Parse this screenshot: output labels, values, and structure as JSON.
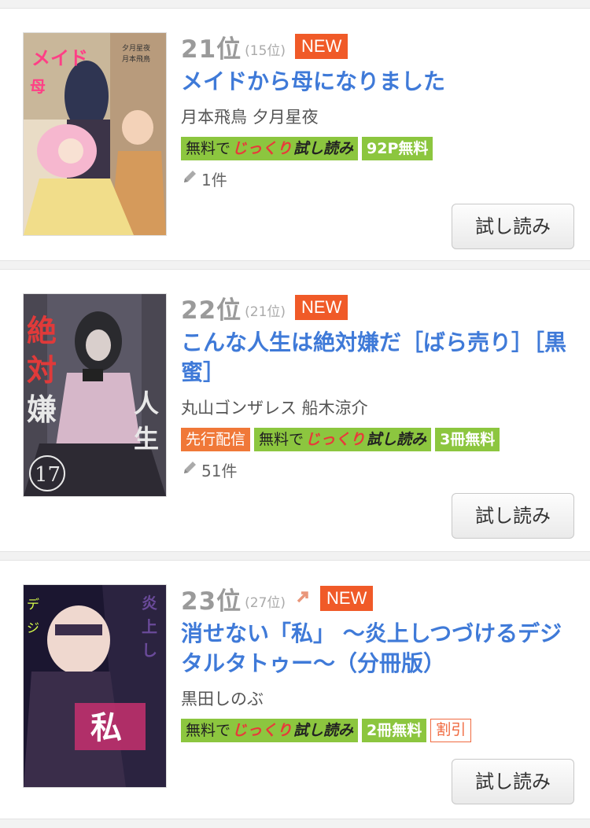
{
  "items": [
    {
      "rank": "21位",
      "prev": "(15位)",
      "new_badge": "NEW",
      "title": "メイドから母になりました",
      "authors": "月本飛鳥 夕月星夜",
      "trial": {
        "free": "無料で",
        "slow": "じっくり",
        "read": "試し読み"
      },
      "badge_free": "92P無料",
      "review_count": "1件",
      "button": "試し読み"
    },
    {
      "rank": "22位",
      "prev": "(21位)",
      "new_badge": "NEW",
      "title": "こんな人生は絶対嫌だ［ばら売り］［黒蜜］",
      "authors": "丸山ゴンザレス 船木涼介",
      "pre_release": "先行配信",
      "trial": {
        "free": "無料で",
        "slow": "じっくり",
        "read": "試し読み"
      },
      "badge_free": "3冊無料",
      "review_count": "51件",
      "button": "試し読み"
    },
    {
      "rank": "23位",
      "prev": "(27位)",
      "new_badge": "NEW",
      "title": "消せない「私」 ～炎上しつづけるデジタルタトゥー～（分冊版）",
      "authors": "黒田しのぶ",
      "trial": {
        "free": "無料で",
        "slow": "じっくり",
        "read": "試し読み"
      },
      "badge_free": "2冊無料",
      "sale": "割引",
      "button": "試し読み"
    }
  ],
  "colors": {
    "rank": "#9a9a9a",
    "title": "#3f7ad8",
    "new": "#f05a28",
    "green": "#8cc63f",
    "orange": "#f07838"
  },
  "icons": {
    "review": "pencil-icon",
    "trend": "arrow-up-right-icon"
  }
}
